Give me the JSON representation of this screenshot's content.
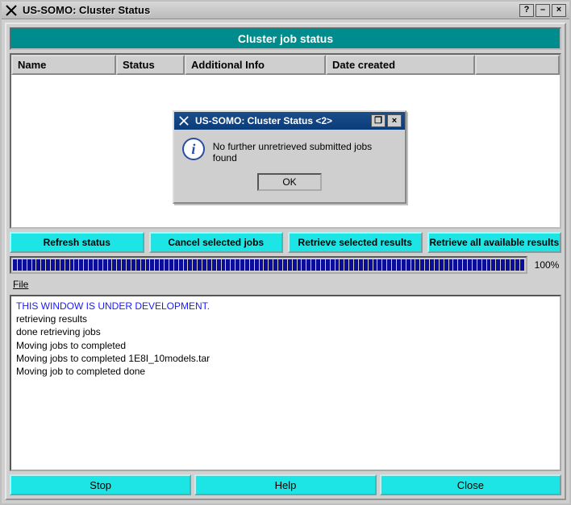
{
  "window": {
    "title": "US-SOMO: Cluster Status",
    "help_hint": "?",
    "min_glyph": "–",
    "close_glyph": "×"
  },
  "header": {
    "label": "Cluster job status"
  },
  "table": {
    "columns": {
      "name": "Name",
      "status": "Status",
      "info": "Additional Info",
      "date": "Date created"
    },
    "rows": []
  },
  "modal": {
    "title": "US-SOMO: Cluster Status <2>",
    "message": "No further unretrieved submitted jobs found",
    "ok_label": "OK",
    "restore_glyph": "❐",
    "close_glyph": "×"
  },
  "actions": {
    "refresh": "Refresh status",
    "cancel": "Cancel selected jobs",
    "retrieve_selected": "Retrieve selected results",
    "retrieve_all": "Retrieve all available results"
  },
  "progress": {
    "segments": 108,
    "percent_label": "100%"
  },
  "menu": {
    "file": "File"
  },
  "log": {
    "dev_line": "THIS WINDOW IS UNDER DEVELOPMENT.",
    "lines": [
      "retrieving results",
      "done retrieving jobs",
      "Moving jobs to completed",
      "Moving jobs to completed 1E8I_10models.tar",
      "Moving job to completed done"
    ]
  },
  "bottom": {
    "stop": "Stop",
    "help": "Help",
    "close": "Close"
  }
}
